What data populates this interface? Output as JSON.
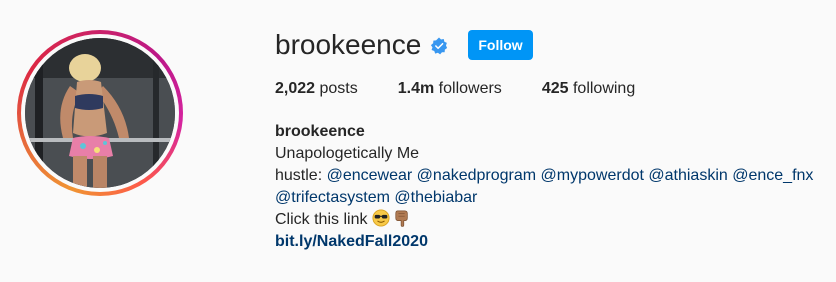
{
  "profile": {
    "username": "brookeence",
    "follow_label": "Follow",
    "stats": {
      "posts_count": "2,022",
      "posts_label": "posts",
      "followers_count": "1.4m",
      "followers_label": "followers",
      "following_count": "425",
      "following_label": "following"
    },
    "bio": {
      "name": "brookeence",
      "line1": "Unapologetically Me",
      "hustle_prefix": "hustle: ",
      "mentions_line2": [
        "@encewear",
        "@nakedprogram",
        "@mypowerdot",
        "@athiaskin",
        "@ence_fnx"
      ],
      "mentions_line3": [
        "@trifectasystem",
        "@thebiabar"
      ],
      "click_text": "Click this link ",
      "link": "bit.ly/NakedFall2020"
    }
  },
  "colors": {
    "accent_blue": "#0095f6",
    "link_blue": "#00376b",
    "verified_blue": "#3897f0",
    "text": "#262626",
    "background": "#fafafa"
  },
  "icons": {
    "verified": "verified-badge-icon",
    "sunglasses": "sunglasses-emoji-icon",
    "pointing": "point-down-emoji-icon"
  }
}
